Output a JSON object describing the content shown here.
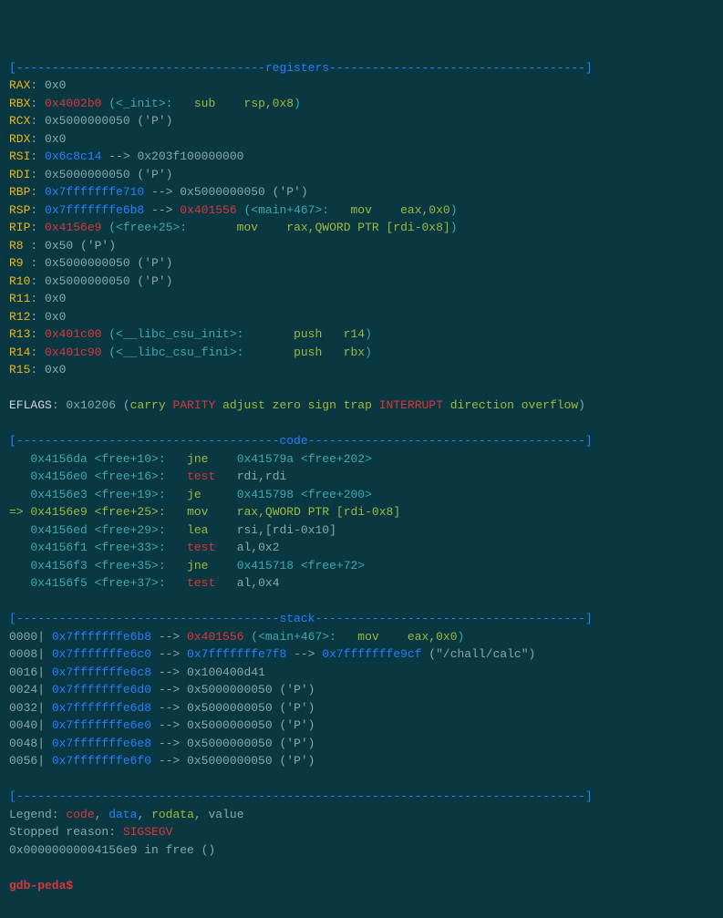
{
  "sections": {
    "registers_header": "[-----------------------------------registers------------------------------------]",
    "code_header": "[-------------------------------------code---------------------------------------]",
    "stack_header": "[-------------------------------------stack--------------------------------------]",
    "hr": "[--------------------------------------------------------------------------------]"
  },
  "registers": [
    {
      "name": "RAX",
      "v": "0x0",
      "vc": "gray"
    },
    {
      "name": "RBX",
      "v": "0x4002b0",
      "vc": "red",
      "extra_sys": " (<_init>:",
      "extra_green": "   sub    rsp,0x8",
      "close": ")"
    },
    {
      "name": "RCX",
      "v": "0x5000000050 ('P')",
      "vc": "gray"
    },
    {
      "name": "RDX",
      "v": "0x0",
      "vc": "gray"
    },
    {
      "name": "RSI",
      "v": "0x6c8c14",
      "vc": "blue",
      "arrow": " --> 0x203f100000000"
    },
    {
      "name": "RDI",
      "v": "0x5000000050 ('P')",
      "vc": "gray"
    },
    {
      "name": "RBP",
      "v": "0x7fffffffe710",
      "vc": "blue",
      "arrow": " --> 0x5000000050 ('P')"
    },
    {
      "name": "RSP",
      "v": "0x7fffffffe6b8",
      "vc": "blue",
      "arrow": " --> ",
      "v2": "0x401556",
      "v2c": "red",
      "extra_sys": " (<main+467>:",
      "extra_green": "   mov    eax,0x0",
      "close": ")"
    },
    {
      "name": "RIP",
      "v": "0x4156e9",
      "vc": "red",
      "extra_sys": " (<free+25>:",
      "extra_green": "       mov    rax,QWORD PTR [rdi-0x8]",
      "close": ")"
    },
    {
      "name": "R8 ",
      "v": "0x50 ('P')",
      "vc": "gray"
    },
    {
      "name": "R9 ",
      "v": "0x5000000050 ('P')",
      "vc": "gray"
    },
    {
      "name": "R10",
      "v": "0x5000000050 ('P')",
      "vc": "gray"
    },
    {
      "name": "R11",
      "v": "0x0",
      "vc": "gray"
    },
    {
      "name": "R12",
      "v": "0x0",
      "vc": "gray"
    },
    {
      "name": "R13",
      "v": "0x401c00",
      "vc": "red",
      "extra_sys": " (<__libc_csu_init>:",
      "extra_green": "       push   r14",
      "close": ")"
    },
    {
      "name": "R14",
      "v": "0x401c90",
      "vc": "red",
      "extra_sys": " (<__libc_csu_fini>:",
      "extra_green": "       push   rbx",
      "close": ")"
    },
    {
      "name": "R15",
      "v": "0x0",
      "vc": "gray"
    }
  ],
  "eflags": {
    "label": "EFLAGS",
    "value": "0x10206",
    "open": " (",
    "flags": [
      {
        "t": "carry ",
        "c": "green"
      },
      {
        "t": "PARITY",
        "c": "red"
      },
      {
        "t": " adjust zero sign trap ",
        "c": "green"
      },
      {
        "t": "INTERRUPT",
        "c": "red"
      },
      {
        "t": " direction overflow",
        "c": "green"
      }
    ],
    "close": ")"
  },
  "code": [
    {
      "p": "   ",
      "addr": "0x4156da",
      "sym": " <free+10>",
      "colon": ":   ",
      "mn": "jne",
      "mnc": "green",
      "sp": "    ",
      "args": "0x41579a <free+202>",
      "argc": "syscol"
    },
    {
      "p": "   ",
      "addr": "0x4156e0",
      "sym": " <free+16>",
      "colon": ":   ",
      "mn": "test",
      "mnc": "red",
      "sp": "   ",
      "args": "rdi,rdi",
      "argc": "gray"
    },
    {
      "p": "   ",
      "addr": "0x4156e3",
      "sym": " <free+19>",
      "colon": ":   ",
      "mn": "je",
      "mnc": "green",
      "sp": "     ",
      "args": "0x415798 <free+200>",
      "argc": "syscol"
    },
    {
      "p": "=> ",
      "addr": "0x4156e9",
      "sym": " <free+25>",
      "colon": ":   ",
      "mn": "mov",
      "mnc": "green",
      "sp": "    ",
      "args": "rax,QWORD PTR [rdi-0x8]",
      "argc": "green",
      "hl": true
    },
    {
      "p": "   ",
      "addr": "0x4156ed",
      "sym": " <free+29>",
      "colon": ":   ",
      "mn": "lea",
      "mnc": "green",
      "sp": "    ",
      "args": "rsi,[rdi-0x10]",
      "argc": "gray"
    },
    {
      "p": "   ",
      "addr": "0x4156f1",
      "sym": " <free+33>",
      "colon": ":   ",
      "mn": "test",
      "mnc": "red",
      "sp": "   ",
      "args": "al,0x2",
      "argc": "gray"
    },
    {
      "p": "   ",
      "addr": "0x4156f3",
      "sym": " <free+35>",
      "colon": ":   ",
      "mn": "jne",
      "mnc": "green",
      "sp": "    ",
      "args": "0x415718 <free+72>",
      "argc": "syscol"
    },
    {
      "p": "   ",
      "addr": "0x4156f5",
      "sym": " <free+37>",
      "colon": ":   ",
      "mn": "test",
      "mnc": "red",
      "sp": "   ",
      "args": "al,0x4",
      "argc": "gray"
    }
  ],
  "stack": [
    {
      "off": "0000| ",
      "addr": "0x7fffffffe6b8",
      "arrow": " --> ",
      "v": "0x401556",
      "vc": "red",
      "extra_sys": " (<main+467>:",
      "extra_green": "   mov    eax,0x0",
      "close": ")"
    },
    {
      "off": "0008| ",
      "addr": "0x7fffffffe6c0",
      "arrow": " --> ",
      "v": "0x7fffffffe7f8",
      "vc": "blue",
      "arrow2": " --> ",
      "v2": "0x7fffffffe9cf",
      "v2c": "blue",
      "extra_plain": " (\"/chall/calc\")"
    },
    {
      "off": "0016| ",
      "addr": "0x7fffffffe6c8",
      "arrow": " --> ",
      "v": "0x100400d41",
      "vc": "gray"
    },
    {
      "off": "0024| ",
      "addr": "0x7fffffffe6d0",
      "arrow": " --> ",
      "v": "0x5000000050 ('P')",
      "vc": "gray"
    },
    {
      "off": "0032| ",
      "addr": "0x7fffffffe6d8",
      "arrow": " --> ",
      "v": "0x5000000050 ('P')",
      "vc": "gray"
    },
    {
      "off": "0040| ",
      "addr": "0x7fffffffe6e0",
      "arrow": " --> ",
      "v": "0x5000000050 ('P')",
      "vc": "gray"
    },
    {
      "off": "0048| ",
      "addr": "0x7fffffffe6e8",
      "arrow": " --> ",
      "v": "0x5000000050 ('P')",
      "vc": "gray"
    },
    {
      "off": "0056| ",
      "addr": "0x7fffffffe6f0",
      "arrow": " --> ",
      "v": "0x5000000050 ('P')",
      "vc": "gray"
    }
  ],
  "legend": {
    "label": "Legend: ",
    "code": "code",
    "s1": ", ",
    "data": "data",
    "s2": ", ",
    "rodata": "rodata",
    "s3": ", value"
  },
  "stopped": {
    "label": "Stopped reason: ",
    "reason": "SIGSEGV"
  },
  "location": "0x00000000004156e9 in free ()",
  "prompt": "gdb-peda$ "
}
